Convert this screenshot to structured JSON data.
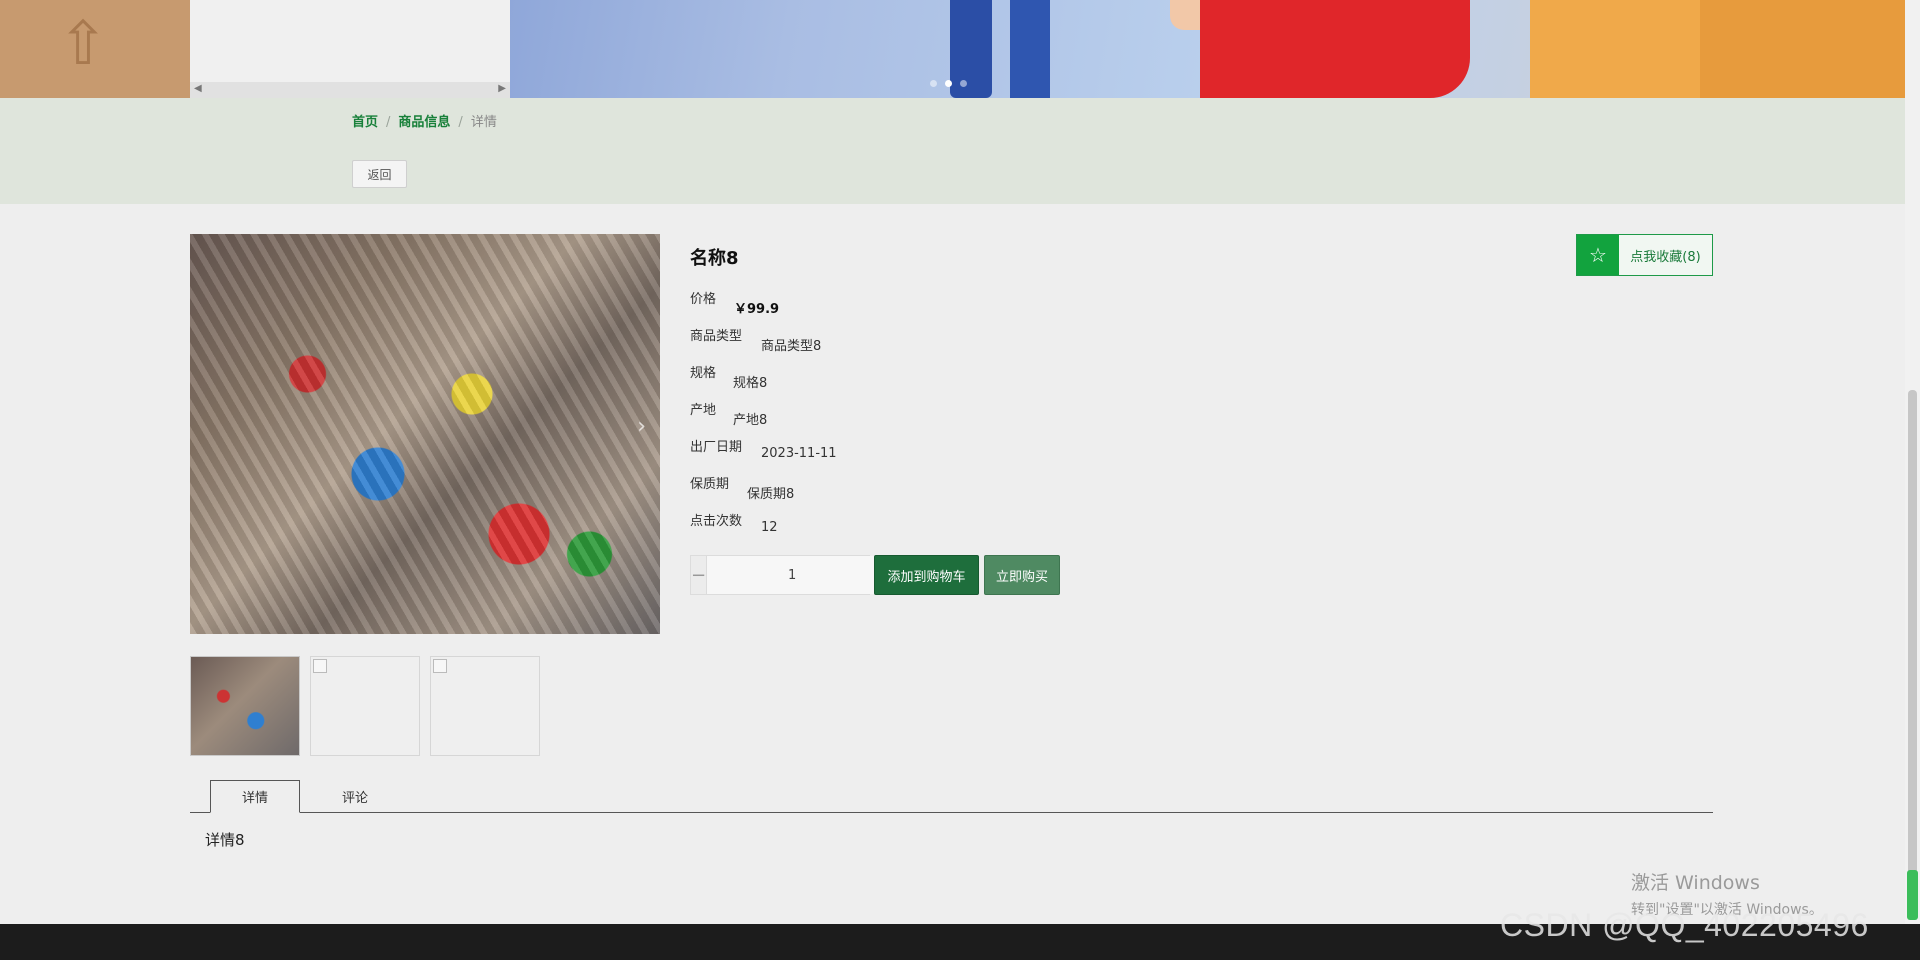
{
  "banner": {
    "slides": 3,
    "active_slide": 2
  },
  "breadcrumb": {
    "home": "首页",
    "category": "商品信息",
    "current": "详情",
    "separator": "/"
  },
  "back_label": "返回",
  "product": {
    "name": "名称8",
    "fields": [
      {
        "label": "价格",
        "value": "￥99.9"
      },
      {
        "label": "商品类型",
        "value": "商品类型8"
      },
      {
        "label": "规格",
        "value": "规格8"
      },
      {
        "label": "产地",
        "value": "产地8"
      },
      {
        "label": "出厂日期",
        "value": "2023-11-11"
      },
      {
        "label": "保质期",
        "value": "保质期8"
      },
      {
        "label": "点击次数",
        "value": "12"
      }
    ],
    "quantity": "1",
    "minus_symbol": "−",
    "plus_symbol": "+",
    "add_to_cart": "添加到购物车",
    "buy_now": "立即购买",
    "favorite": "点我收藏(8)"
  },
  "tabs": [
    {
      "label": "详情",
      "active": true
    },
    {
      "label": "评论",
      "active": false
    }
  ],
  "detail_text": "详情8",
  "windows_watermark": {
    "line1": "激活 Windows",
    "line2": "转到\"设置\"以激活 Windows。"
  },
  "csdn_watermark": "CSDN @QQ_402205496",
  "colors": {
    "accent": "#18803a",
    "cart_button": "#1e6e3c",
    "buy_button": "#4f8a62",
    "favorite": "#12a33e"
  },
  "icons": {
    "favorite": "star-icon",
    "minus": "minus-icon",
    "plus": "plus-icon"
  }
}
